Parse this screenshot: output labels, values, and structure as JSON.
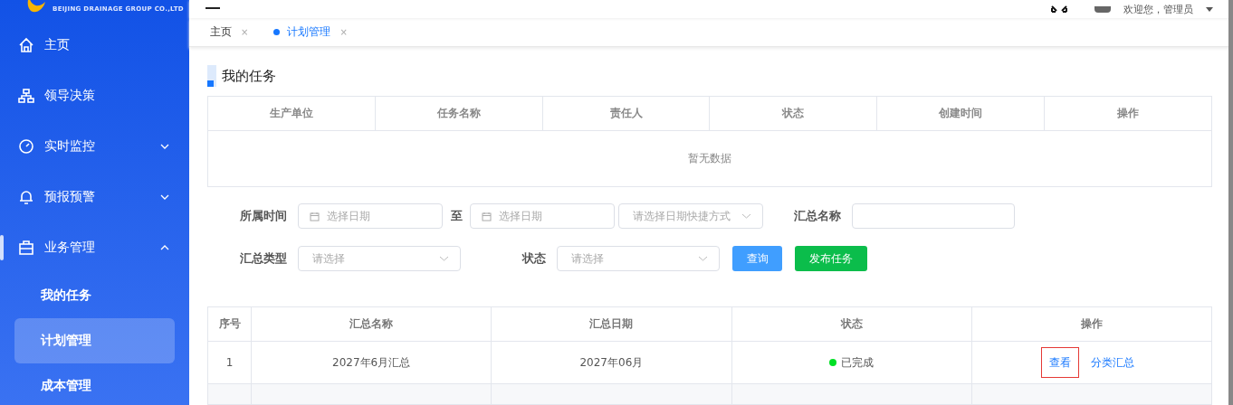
{
  "logo": {
    "subtitle": "BEIJING DRAINAGE GROUP CO.,LTD"
  },
  "sidebar": {
    "items": [
      {
        "label": "主页",
        "kind": "link"
      },
      {
        "label": "领导决策",
        "kind": "link"
      },
      {
        "label": "实时监控",
        "kind": "group",
        "expanded": false
      },
      {
        "label": "预报预警",
        "kind": "group",
        "expanded": false
      },
      {
        "label": "业务管理",
        "kind": "group",
        "expanded": true,
        "children": [
          {
            "label": "我的任务",
            "selected": false
          },
          {
            "label": "计划管理",
            "selected": true
          },
          {
            "label": "成本管理",
            "selected": false
          }
        ]
      }
    ]
  },
  "header": {
    "user": "欢迎您，管理员"
  },
  "tabs": [
    {
      "label": "主页",
      "selected": false,
      "close": "×"
    },
    {
      "label": "计划管理",
      "selected": true,
      "close": "×"
    }
  ],
  "section_title": "我的任务",
  "task_table": {
    "columns": [
      "生产单位",
      "任务名称",
      "责任人",
      "状态",
      "创建时间",
      "操作"
    ],
    "empty_text": "暂无数据"
  },
  "filters": {
    "time_label": "所属时间",
    "start_placeholder": "选择日期",
    "to": "至",
    "end_placeholder": "选择日期",
    "shortcut_placeholder": "请选择日期快捷方式",
    "name_label": "汇总名称",
    "type_label": "汇总类型",
    "type_placeholder": "请选择",
    "status_label": "状态",
    "status_placeholder": "请选择"
  },
  "buttons": [
    {
      "label": "查询",
      "kind": "query"
    },
    {
      "label": "发布任务",
      "kind": "publish"
    }
  ],
  "summary_table": {
    "columns": [
      "序号",
      "汇总名称",
      "汇总日期",
      "状态",
      "操作"
    ],
    "rows": [
      {
        "index": "1",
        "name": "2027年6月汇总",
        "date": "2027年06月",
        "status": "已完成",
        "color": "#00e025",
        "actions": [
          {
            "label": "查看",
            "selected": true
          },
          {
            "label": "分类汇总",
            "selected": false
          }
        ]
      }
    ]
  }
}
